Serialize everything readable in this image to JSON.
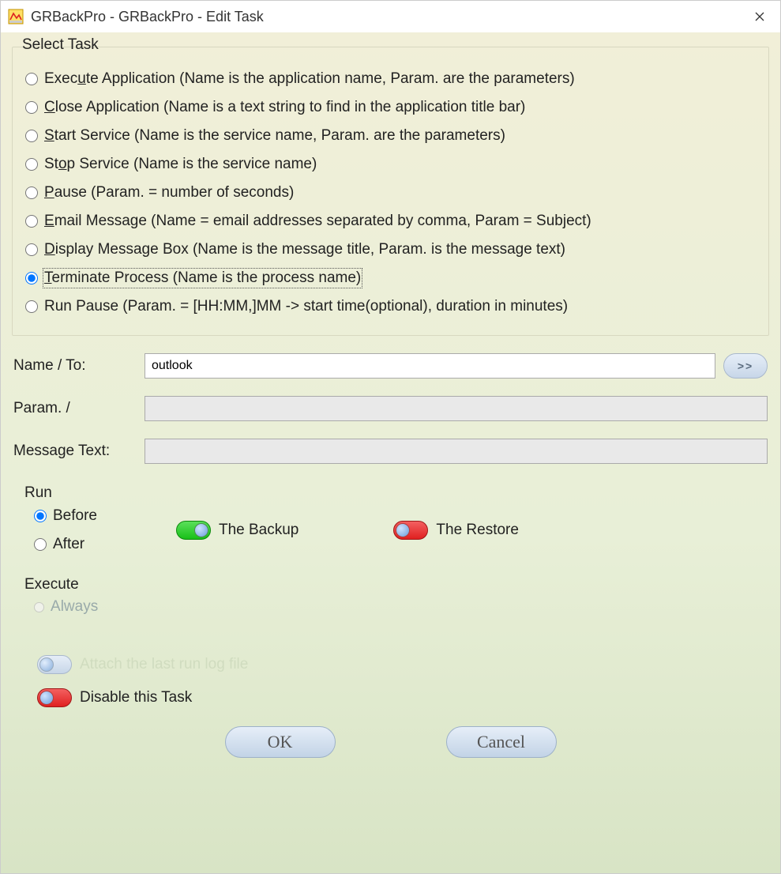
{
  "title": "GRBackPro - GRBackPro - Edit Task",
  "group": {
    "legend": "Select Task",
    "options": [
      {
        "prefix": "Exec",
        "u": "u",
        "rest": "te Application (Name is the application name, Param. are the parameters)"
      },
      {
        "prefix": "",
        "u": "C",
        "rest": "lose Application (Name is a text string to find in the application title bar)"
      },
      {
        "prefix": "",
        "u": "S",
        "rest": "tart Service  (Name is the service name, Param. are the parameters)"
      },
      {
        "prefix": "St",
        "u": "o",
        "rest": "p Service  (Name is the service name)"
      },
      {
        "prefix": "",
        "u": "P",
        "rest": "ause  (Param. = number of seconds)"
      },
      {
        "prefix": "",
        "u": "E",
        "rest": "mail Message (Name = email addresses separated by comma, Param =  Subject)"
      },
      {
        "prefix": "",
        "u": "D",
        "rest": "isplay Message Box (Name is the message title, Param. is the message text)"
      },
      {
        "prefix": "",
        "u": "T",
        "rest": "erminate Process (Name is the process name)"
      },
      {
        "prefix": "",
        "u": "",
        "rest": "Run Pause (Param. = [HH:MM,]MM -> start time(optional), duration in minutes)"
      }
    ],
    "selected_index": 7
  },
  "form": {
    "name_label": "Name / To:",
    "name_value": "outlook",
    "more_label": ">>",
    "param_label": "Param. /",
    "param_value": "",
    "msg_label": "Message Text:",
    "msg_value": ""
  },
  "run": {
    "title": "Run",
    "before": "Before",
    "after": "After",
    "selected": "before",
    "backup_label": "The Backup",
    "backup_on": true,
    "restore_label": "The Restore",
    "restore_on": false
  },
  "execute": {
    "title": "Execute",
    "always_prefix": "",
    "always_u": "A",
    "always_rest": "lways"
  },
  "bottom": {
    "attach_label": "Attach the last run log file",
    "disable_label": "Disable this Task"
  },
  "buttons": {
    "ok": "OK",
    "cancel": "Cancel"
  }
}
